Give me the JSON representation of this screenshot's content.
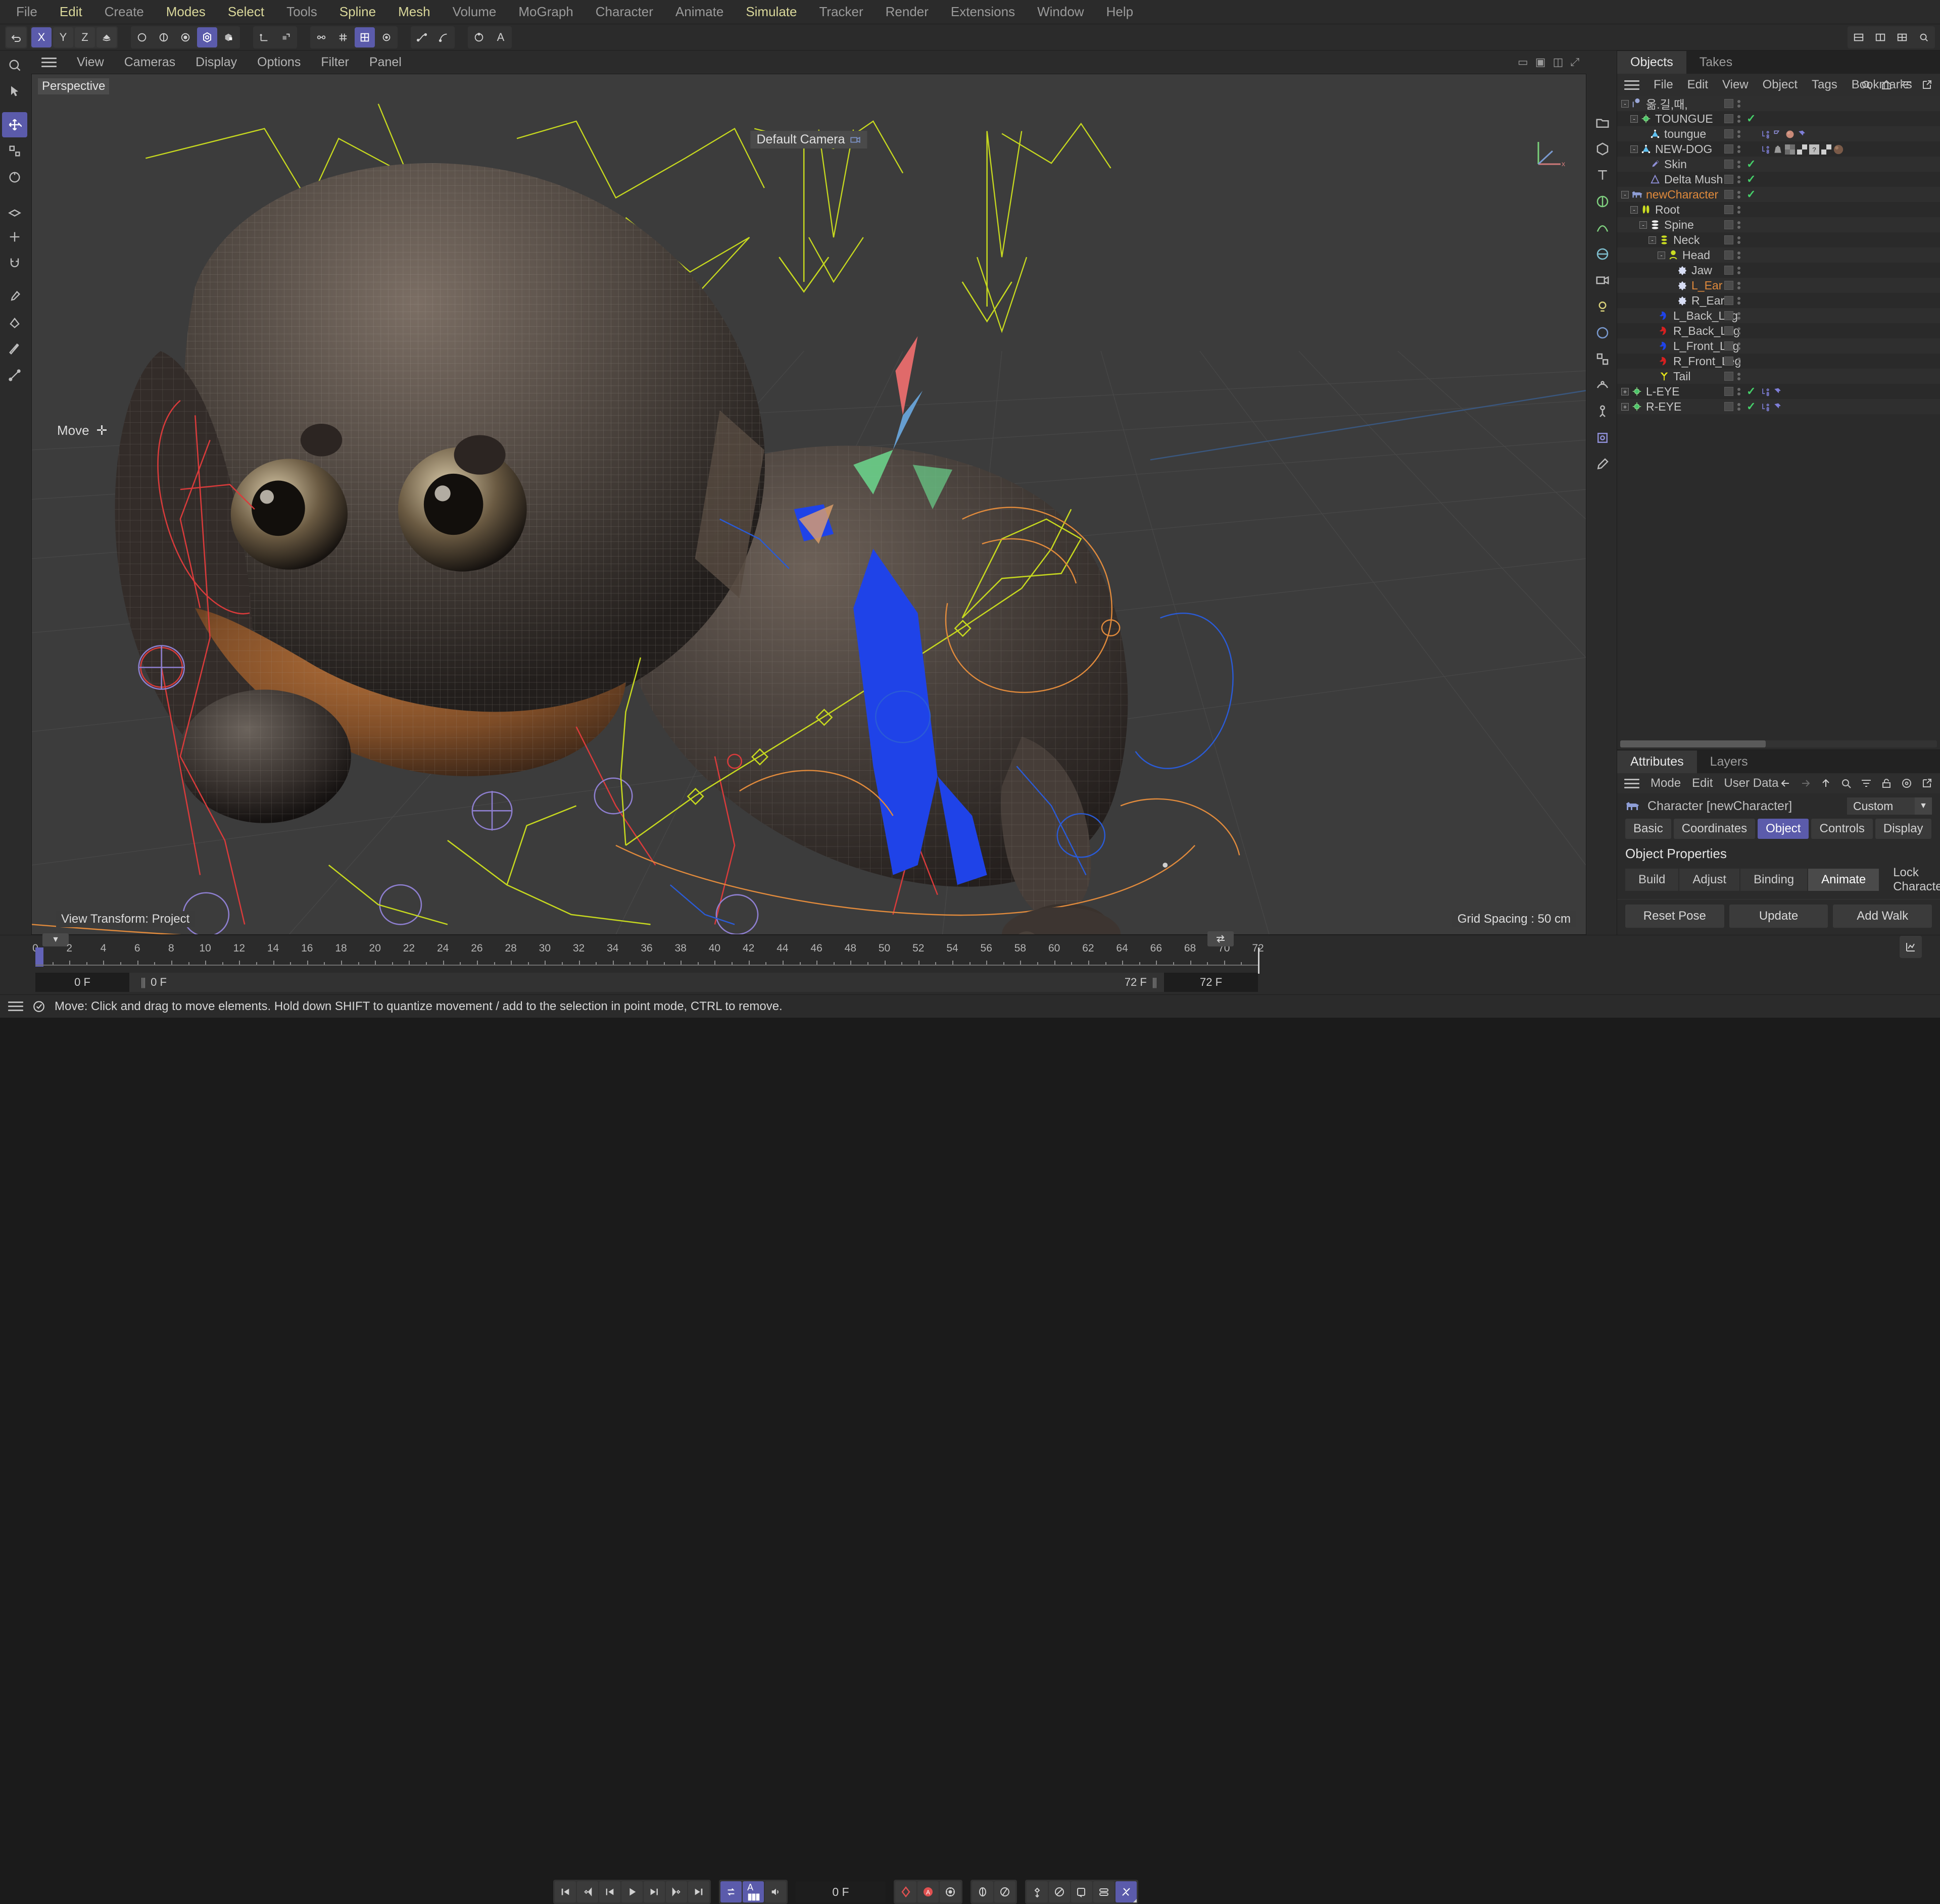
{
  "app": {
    "viewport_label": "Perspective",
    "camera_label": "Default Camera",
    "view_transform": "View Transform: Project",
    "grid_spacing": "Grid Spacing : 50 cm",
    "move_hint": "Move"
  },
  "menubar": {
    "items": [
      {
        "label": "File",
        "style": "g"
      },
      {
        "label": "Edit",
        "style": "y"
      },
      {
        "label": "Create",
        "style": "g"
      },
      {
        "label": "Modes",
        "style": "y"
      },
      {
        "label": "Select",
        "style": "y"
      },
      {
        "label": "Tools",
        "style": "g"
      },
      {
        "label": "Spline",
        "style": "y"
      },
      {
        "label": "Mesh",
        "style": "y"
      },
      {
        "label": "Volume",
        "style": "g"
      },
      {
        "label": "MoGraph",
        "style": "g"
      },
      {
        "label": "Character",
        "style": "g"
      },
      {
        "label": "Animate",
        "style": "g"
      },
      {
        "label": "Simulate",
        "style": "y"
      },
      {
        "label": "Tracker",
        "style": "g"
      },
      {
        "label": "Render",
        "style": "g"
      },
      {
        "label": "Extensions",
        "style": "g"
      },
      {
        "label": "Window",
        "style": "g"
      },
      {
        "label": "Help",
        "style": "g"
      }
    ]
  },
  "viewport_menu": {
    "items": [
      "View",
      "Cameras",
      "Display",
      "Options",
      "Filter",
      "Panel"
    ]
  },
  "object_manager": {
    "tabs": [
      {
        "label": "Objects",
        "active": true
      },
      {
        "label": "Takes",
        "active": false
      }
    ],
    "menu": [
      "File",
      "Edit",
      "View",
      "Object",
      "Tags",
      "Bookmarks"
    ],
    "items": [
      {
        "label": "옮.길,때,",
        "indent": 0,
        "icon": "null-object-icon",
        "expander": "-",
        "color": "normal",
        "check": false,
        "tags": []
      },
      {
        "label": "TOUNGUE",
        "indent": 1,
        "icon": "point-object-icon",
        "expander": "-",
        "color": "normal",
        "check": true,
        "tags": []
      },
      {
        "label": "toungue",
        "indent": 2,
        "icon": "polygon-object-icon",
        "expander": "",
        "color": "normal",
        "check": false,
        "tags": [
          "xpresso-tag",
          "phong-tag",
          "material-tag",
          "pin-tag"
        ]
      },
      {
        "label": "NEW-DOG",
        "indent": 1,
        "icon": "polygon-object-icon",
        "expander": "-",
        "color": "normal",
        "check": false,
        "tags": [
          "xpresso-tag",
          "weight-tag",
          "tex1-tag",
          "tex2-tag",
          "unknown-tag",
          "tex3-tag",
          "tex4-tag"
        ]
      },
      {
        "label": "Skin",
        "indent": 2,
        "icon": "skin-deformer-icon",
        "expander": "",
        "color": "normal",
        "check": true,
        "tags": []
      },
      {
        "label": "Delta Mush",
        "indent": 2,
        "icon": "delta-mush-icon",
        "expander": "",
        "color": "normal",
        "check": true,
        "tags": []
      },
      {
        "label": "newCharacter",
        "indent": 0,
        "icon": "character-icon",
        "expander": "-",
        "color": "orange",
        "check": true,
        "tags": []
      },
      {
        "label": "Root",
        "indent": 1,
        "icon": "root-component-icon",
        "expander": "-",
        "color": "normal",
        "check": false,
        "tags": []
      },
      {
        "label": "Spine",
        "indent": 2,
        "icon": "spine-component-icon",
        "expander": "-",
        "color": "normal",
        "check": false,
        "tags": []
      },
      {
        "label": "Neck",
        "indent": 3,
        "icon": "neck-component-icon",
        "expander": "-",
        "color": "normal",
        "check": false,
        "tags": []
      },
      {
        "label": "Head",
        "indent": 4,
        "icon": "head-component-icon",
        "expander": "-",
        "color": "normal",
        "check": false,
        "tags": []
      },
      {
        "label": "Jaw",
        "indent": 5,
        "icon": "joint-component-icon",
        "expander": "",
        "color": "normal",
        "check": false,
        "tags": []
      },
      {
        "label": "L_Ear",
        "indent": 5,
        "icon": "joint-component-icon",
        "expander": "",
        "color": "orange",
        "check": false,
        "tags": []
      },
      {
        "label": "R_Ear",
        "indent": 5,
        "icon": "joint-component-icon",
        "expander": "",
        "color": "normal",
        "check": false,
        "tags": []
      },
      {
        "label": "L_Back_Leg",
        "indent": 3,
        "icon": "leg-blue-icon",
        "expander": "",
        "color": "normal",
        "check": false,
        "tags": []
      },
      {
        "label": "R_Back_Leg",
        "indent": 3,
        "icon": "leg-red-icon",
        "expander": "",
        "color": "normal",
        "check": false,
        "tags": []
      },
      {
        "label": "L_Front_Leg",
        "indent": 3,
        "icon": "leg-blue-icon",
        "expander": "",
        "color": "normal",
        "check": false,
        "tags": []
      },
      {
        "label": "R_Front_Leg",
        "indent": 3,
        "icon": "leg-red-icon",
        "expander": "",
        "color": "normal",
        "check": false,
        "tags": []
      },
      {
        "label": "Tail",
        "indent": 3,
        "icon": "tail-component-icon",
        "expander": "",
        "color": "normal",
        "check": false,
        "tags": []
      },
      {
        "label": "L-EYE",
        "indent": 0,
        "icon": "point-object-icon",
        "expander": "+",
        "color": "normal",
        "check": true,
        "tags": [
          "xpresso-tag",
          "pin-tag"
        ]
      },
      {
        "label": "R-EYE",
        "indent": 0,
        "icon": "point-object-icon",
        "expander": "+",
        "color": "normal",
        "check": true,
        "tags": [
          "xpresso-tag",
          "pin-tag"
        ]
      }
    ]
  },
  "attributes": {
    "tabs": [
      {
        "label": "Attributes",
        "active": true
      },
      {
        "label": "Layers",
        "active": false
      }
    ],
    "menu": [
      "Mode",
      "Edit",
      "User Data"
    ],
    "object_title": "Character [newCharacter]",
    "preset": "Custom",
    "tabs_row": [
      {
        "label": "Basic",
        "active": false
      },
      {
        "label": "Coordinates",
        "active": false
      },
      {
        "label": "Object",
        "active": true
      },
      {
        "label": "Controls",
        "active": false
      },
      {
        "label": "Display",
        "active": false
      }
    ],
    "section_title": "Object Properties",
    "modes": [
      {
        "label": "Build",
        "active": false
      },
      {
        "label": "Adjust",
        "active": false
      },
      {
        "label": "Binding",
        "active": false
      },
      {
        "label": "Animate",
        "active": true
      }
    ],
    "lock_label": "Lock Character",
    "lock_checked": false,
    "buttons": [
      "Reset Pose",
      "Update",
      "Add Walk"
    ]
  },
  "timeline": {
    "ticks": [
      0,
      2,
      4,
      6,
      8,
      10,
      12,
      14,
      16,
      18,
      20,
      22,
      24,
      26,
      28,
      30,
      32,
      34,
      36,
      38,
      40,
      42,
      44,
      46,
      48,
      50,
      52,
      54,
      56,
      58,
      60,
      62,
      64,
      66,
      68,
      70,
      72
    ],
    "start_frame": "0 F",
    "current_frame": "0 F",
    "end_frame": "72 F",
    "preview_end": "72 F",
    "playhead_frame": 0,
    "range_end": 72
  },
  "transport": {
    "frame_field": "0 F",
    "buttons": [
      "go-to-start-icon",
      "previous-key-icon",
      "step-back-icon",
      "play-icon",
      "step-forward-icon",
      "next-key-icon",
      "go-to-end-icon"
    ],
    "loop_icon": "loop-icon",
    "sound_icon": "sound-icon",
    "audio_icon": "audio-wave-icon",
    "record_icons": [
      "record-keyframe-icon",
      "autokey-icon",
      "keyframe-selection-icon"
    ],
    "pos_icons": [
      "position-icon",
      "rotation-icon"
    ],
    "param_icons": [
      "pla-icon",
      "param-rotation-icon",
      "animation-layer-icon",
      "point-level-icon",
      "key-tool-icon"
    ]
  },
  "statusbar": {
    "message": "Move: Click and drag to move elements. Hold down SHIFT to quantize movement / add to the selection in point mode, CTRL to remove."
  },
  "colors": {
    "accent": "#5b5bab",
    "panel": "#2b2b2b",
    "viewport_bg": "#3a3a3a",
    "check_green": "#46d06a",
    "orange": "#e08a3c",
    "record_red": "#e05050"
  }
}
